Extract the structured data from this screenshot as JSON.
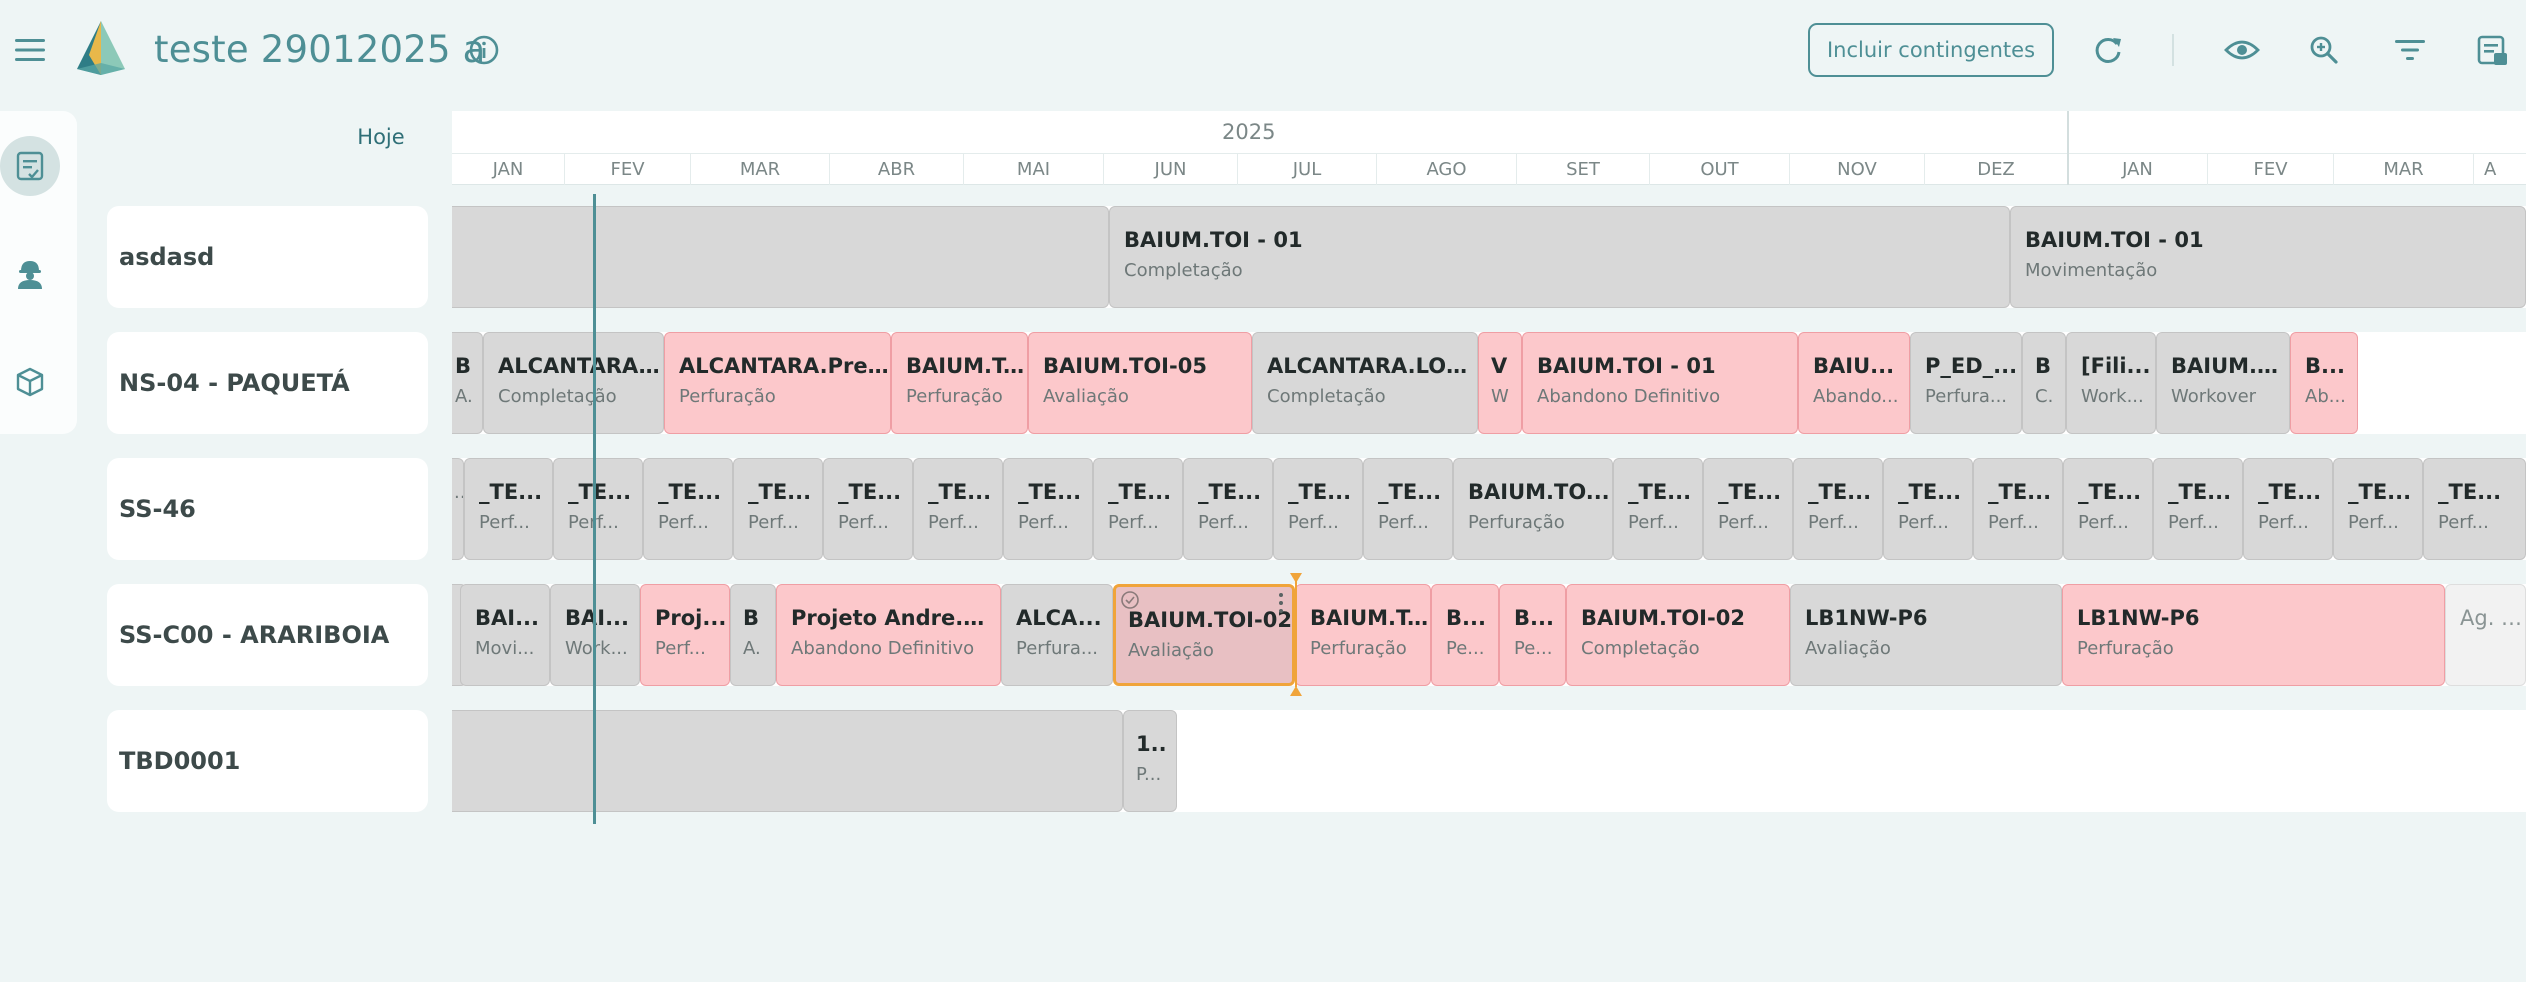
{
  "header": {
    "title": "teste 29012025 a",
    "contingent_button": "Incluir contingentes",
    "icons": [
      "menu-icon",
      "app-logo",
      "info-icon",
      "refresh-icon",
      "eye-icon",
      "zoom-icon",
      "filter-icon",
      "notes-icon"
    ]
  },
  "side_rail": {
    "items": [
      "schedule-icon",
      "worker-icon",
      "package-icon"
    ],
    "active": "schedule-icon"
  },
  "timeline": {
    "today_label": "Hoje",
    "years": [
      "2025"
    ],
    "months": [
      "JAN",
      "FEV",
      "MAR",
      "ABR",
      "MAI",
      "JUN",
      "JUL",
      "AGO",
      "SET",
      "OUT",
      "NOV",
      "DEZ",
      "JAN",
      "FEV",
      "MAR",
      "A"
    ]
  },
  "rows": [
    {
      "label": "asdasd",
      "bars": [
        {
          "title": "",
          "subtitle": "",
          "color": "gray"
        },
        {
          "title": "BAIUM.TOI - 01",
          "subtitle": "Completação",
          "color": "gray"
        },
        {
          "title": "BAIUM.TOI - 01",
          "subtitle": "Movimentação",
          "color": "gray"
        }
      ]
    },
    {
      "label": "NS-04 - PAQUETÁ",
      "bars": [
        {
          "title": "B",
          "subtitle": "A.",
          "color": "gray"
        },
        {
          "title": "ALCANTARA....",
          "subtitle": "Completação",
          "color": "gray"
        },
        {
          "title": "ALCANTARA.Pref ...",
          "subtitle": "Perfuração",
          "color": "pink"
        },
        {
          "title": "BAIUM.T...",
          "subtitle": "Perfuração",
          "color": "pink"
        },
        {
          "title": "BAIUM.TOI-05",
          "subtitle": "Avaliação",
          "color": "pink"
        },
        {
          "title": "ALCANTARA.LOC...",
          "subtitle": "Completação",
          "color": "gray"
        },
        {
          "title": "V",
          "subtitle": "W",
          "color": "pink"
        },
        {
          "title": "BAIUM.TOI - 01",
          "subtitle": "Abandono Definitivo",
          "color": "pink"
        },
        {
          "title": "BAIU...",
          "subtitle": "Abando...",
          "color": "pink"
        },
        {
          "title": "P_ED_...",
          "subtitle": "Perfura...",
          "color": "gray"
        },
        {
          "title": "B",
          "subtitle": "C.",
          "color": "gray"
        },
        {
          "title": "[Fili...",
          "subtitle": "Work...",
          "color": "gray"
        },
        {
          "title": "BAIUM.T...",
          "subtitle": "Workover",
          "color": "gray"
        },
        {
          "title": "B...",
          "subtitle": "Ab...",
          "color": "pink"
        }
      ]
    },
    {
      "label": "SS-46",
      "bars": [
        {
          "title": "",
          "subtitle": "..",
          "color": "gray"
        },
        {
          "title": "_TE...",
          "subtitle": "Perf...",
          "color": "gray"
        },
        {
          "title": "_TE...",
          "subtitle": "Perf...",
          "color": "gray"
        },
        {
          "title": "_TE...",
          "subtitle": "Perf...",
          "color": "gray"
        },
        {
          "title": "_TE...",
          "subtitle": "Perf...",
          "color": "gray"
        },
        {
          "title": "_TE...",
          "subtitle": "Perf...",
          "color": "gray"
        },
        {
          "title": "_TE...",
          "subtitle": "Perf...",
          "color": "gray"
        },
        {
          "title": "_TE...",
          "subtitle": "Perf...",
          "color": "gray"
        },
        {
          "title": "_TE...",
          "subtitle": "Perf...",
          "color": "gray"
        },
        {
          "title": "_TE...",
          "subtitle": "Perf...",
          "color": "gray"
        },
        {
          "title": "_TE...",
          "subtitle": "Perf...",
          "color": "gray"
        },
        {
          "title": "_TE...",
          "subtitle": "Perf...",
          "color": "gray"
        },
        {
          "title": "BAIUM.TO...",
          "subtitle": "Perfuração",
          "color": "gray"
        },
        {
          "title": "_TE...",
          "subtitle": "Perf...",
          "color": "gray"
        },
        {
          "title": "_TE...",
          "subtitle": "Perf...",
          "color": "gray"
        },
        {
          "title": "_TE...",
          "subtitle": "Perf...",
          "color": "gray"
        },
        {
          "title": "_TE...",
          "subtitle": "Perf...",
          "color": "gray"
        },
        {
          "title": "_TE...",
          "subtitle": "Perf...",
          "color": "gray"
        },
        {
          "title": "_TE...",
          "subtitle": "Perf...",
          "color": "gray"
        },
        {
          "title": "_TE...",
          "subtitle": "Perf...",
          "color": "gray"
        },
        {
          "title": "_TE...",
          "subtitle": "Perf...",
          "color": "gray"
        },
        {
          "title": "_TE...",
          "subtitle": "Perf...",
          "color": "gray"
        },
        {
          "title": "_TE...",
          "subtitle": "Perf...",
          "color": "gray"
        }
      ]
    },
    {
      "label": "SS-C00 - ARARIBOIA",
      "bars": [
        {
          "title": "",
          "subtitle": "",
          "color": "gray"
        },
        {
          "title": "BAI...",
          "subtitle": "Movi...",
          "color": "gray"
        },
        {
          "title": "BAI...",
          "subtitle": "Work...",
          "color": "gray"
        },
        {
          "title": "Proj...",
          "subtitle": "Perf...",
          "color": "pink"
        },
        {
          "title": "B",
          "subtitle": "A.",
          "color": "gray"
        },
        {
          "title": "Projeto Andre.Al...",
          "subtitle": "Abandono Definitivo",
          "color": "pink"
        },
        {
          "title": "ALCA...",
          "subtitle": "Perfura...",
          "color": "gray"
        },
        {
          "title": "BAIUM.TOI-02",
          "subtitle": "Avaliação",
          "color": "selected"
        },
        {
          "title": "BAIUM.T...",
          "subtitle": "Perfuração",
          "color": "pink"
        },
        {
          "title": "B...",
          "subtitle": "Pe...",
          "color": "pink"
        },
        {
          "title": "B...",
          "subtitle": "Pe...",
          "color": "pink"
        },
        {
          "title": "BAIUM.TOI-02",
          "subtitle": "Completação",
          "color": "pink"
        },
        {
          "title": "LB1NW-P6",
          "subtitle": "Avaliação",
          "color": "gray"
        },
        {
          "title": "LB1NW-P6",
          "subtitle": "Perfuração",
          "color": "pink"
        },
        {
          "title": "Ag. Pro",
          "subtitle": "",
          "color": "pale"
        }
      ]
    },
    {
      "label": "TBD0001",
      "bars": [
        {
          "title": "",
          "subtitle": "",
          "color": "gray"
        },
        {
          "title": "1..",
          "subtitle": "P...",
          "color": "gray"
        }
      ]
    }
  ],
  "colors": {
    "accent": "#4e8f95",
    "bar_gray": "#d8d8d8",
    "bar_pink": "#fcc8cb",
    "selection": "#f0a43a"
  }
}
